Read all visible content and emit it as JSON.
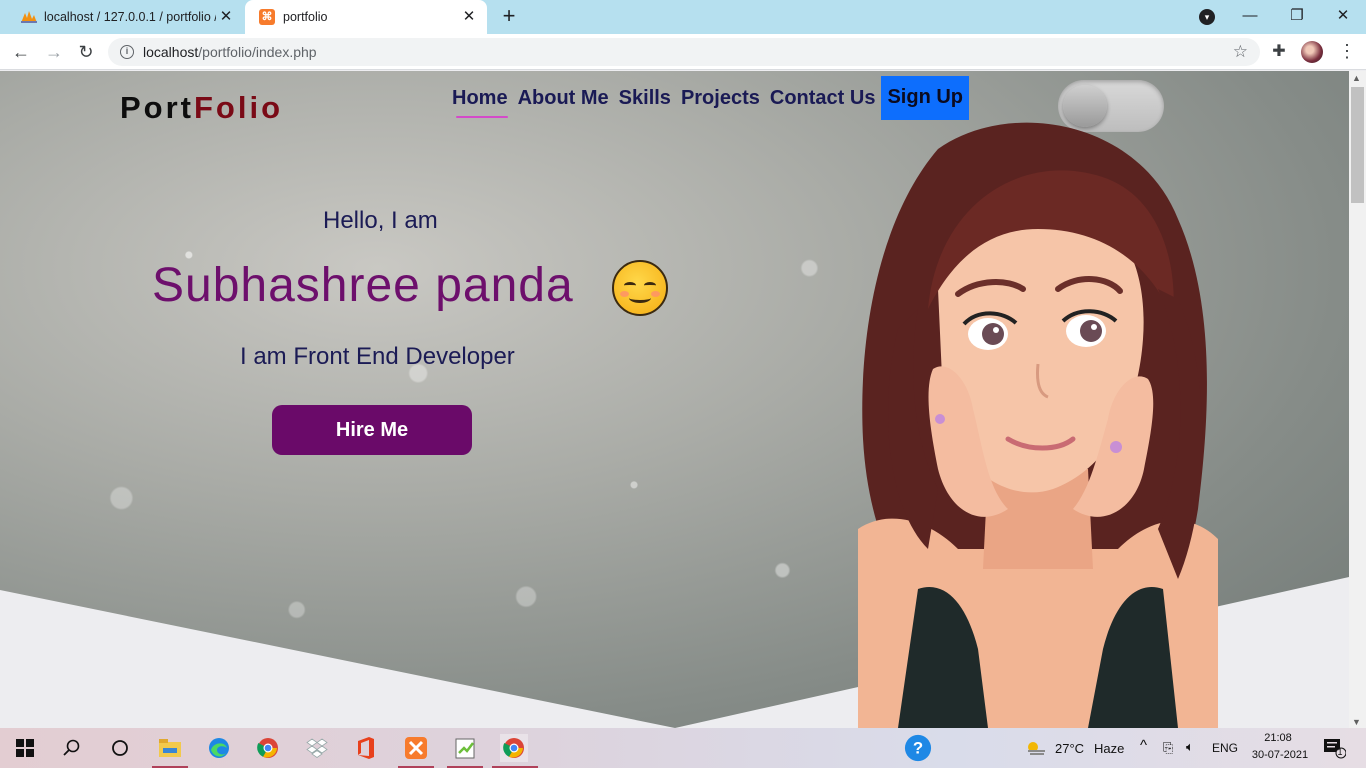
{
  "browser": {
    "tabs": [
      {
        "title": "localhost / 127.0.0.1 / portfolio /",
        "favicon": "phpmyadmin-icon",
        "active": false
      },
      {
        "title": "portfolio",
        "favicon": "xampp-icon",
        "active": true
      }
    ],
    "url_host": "localhost",
    "url_path": "/portfolio/index.php"
  },
  "page": {
    "logo_part1": "Port",
    "logo_part2": "Folio",
    "nav": {
      "home": "Home",
      "about": "About Me",
      "skills": "Skills",
      "projects": "Projects",
      "contact": "Contact Us",
      "signup": "Sign Up"
    },
    "greeting": "Hello, I am",
    "name": "Subhashree panda",
    "role": "I am Front End Developer",
    "hire_button": "Hire Me",
    "theme_toggle_on": false
  },
  "taskbar": {
    "weather_temp": "27°C",
    "weather_desc": "Haze",
    "language": "ENG",
    "time": "21:08",
    "date": "30-07-2021",
    "notification_count": "1"
  },
  "colors": {
    "name": "#6d0f6c",
    "hire_button": "#6a0a69",
    "signup": "#0d6efd",
    "nav_text": "#1a1a55",
    "logo_accent": "#7a0a16",
    "active_underline": "#d44ac9"
  }
}
